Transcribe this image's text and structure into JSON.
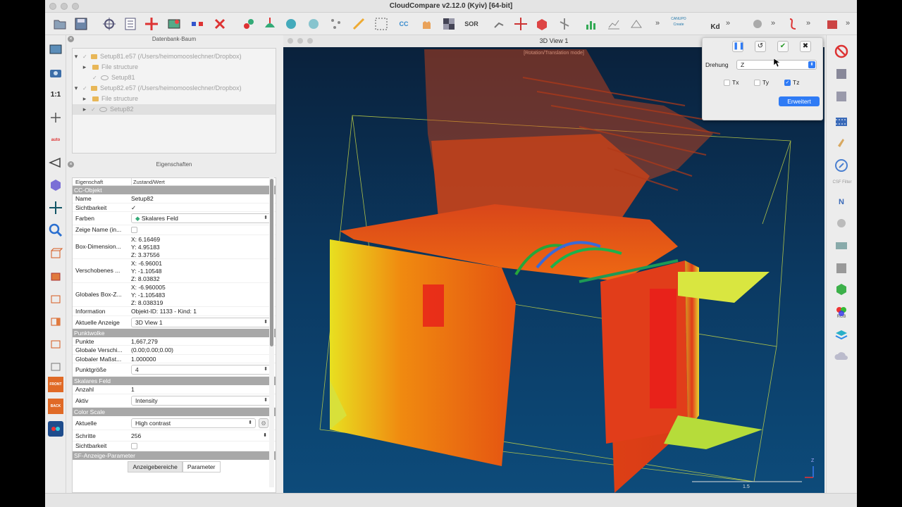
{
  "app": {
    "title": "CloudCompare v2.12.0 (Kyiv) [64-bit]"
  },
  "toolbar": {
    "more1": "»",
    "more2": "»",
    "more3": "»",
    "more4": "»",
    "more5": "»",
    "canupo": "CANUPO",
    "create": "Create",
    "kd": "Kd",
    "sor": "SOR",
    "ccc": "CC"
  },
  "left_toolbar": {
    "scale_label": "1:1",
    "front_label": "FRONT",
    "back_label": "BACK",
    "auto_label": "auto"
  },
  "db_tree": {
    "title": "Datenbank-Baum",
    "items": [
      {
        "label": "Setup81.e57 (/Users/heimomooslechner/Dropbox)"
      },
      {
        "label": "File structure"
      },
      {
        "label": "Setup81"
      },
      {
        "label": "Setup82.e57 (/Users/heimomooslechner/Dropbox)"
      },
      {
        "label": "File structure"
      },
      {
        "label": "Setup82"
      }
    ]
  },
  "properties": {
    "title": "Eigenschaften",
    "col_prop": "Eigenschaft",
    "col_val": "Zustand/Wert",
    "sections": {
      "cc": "CC-Objekt",
      "cloud": "Punktwolke",
      "sf": "Skalares Feld",
      "color": "Color Scale",
      "sfparams": "SF-Anzeige-Parameter"
    },
    "rows": {
      "name_k": "Name",
      "name_v": "Setup82",
      "vis_k": "Sichtbarkeit",
      "vis_v": "✓",
      "colors_k": "Farben",
      "colors_v": "Skalares Feld",
      "showname_k": "Zeige Name (in...",
      "box_k": "Box-Dimension...",
      "box_x": "X: 6.16469",
      "box_y": "Y: 4.95183",
      "box_z": "Z: 3.37556",
      "shift_k": "Verschobenes ...",
      "shift_x": "X: -6.96001",
      "shift_y": "Y: -1.10548",
      "shift_z": "Z: 8.03832",
      "gbox_k": "Globales Box-Z...",
      "gbox_x": "X: -6.960005",
      "gbox_y": "Y: -1.105483",
      "gbox_z": "Z: 8.038319",
      "info_k": "Information",
      "info_v": "Objekt-ID: 1133 - Kind: 1",
      "disp_k": "Aktuelle Anzeige",
      "disp_v": "3D View 1",
      "pts_k": "Punkte",
      "pts_v": "1,667,279",
      "gshift_k": "Globale Verschi...",
      "gshift_v": "(0.00;0.00;0.00)",
      "gscale_k": "Globaler Maßst...",
      "gscale_v": "1.000000",
      "psize_k": "Punktgröße",
      "psize_v": "4",
      "count_k": "Anzahl",
      "count_v": "1",
      "active_k": "Aktiv",
      "active_v": "Intensity",
      "cur_k": "Aktuelle",
      "cur_v": "High contrast",
      "steps_k": "Schritte",
      "steps_v": "256",
      "svis_k": "Sichtbarkeit"
    },
    "tabs": {
      "ranges": "Anzeigebereiche",
      "params": "Parameter"
    }
  },
  "view": {
    "title": "3D View 1",
    "mode": "[Rotation/Translation mode]",
    "scale_label": "1.5",
    "axis_label": "Z"
  },
  "dialog": {
    "rotation_label": "Drehung",
    "rotation_value": "Z",
    "tx": "Tx",
    "ty": "Ty",
    "tz": "Tz",
    "advanced": "Erweitert"
  },
  "right_toolbar": {
    "csf": "CSF Filter",
    "n_label": "N",
    "rgb": "RGB"
  },
  "colors": {
    "accent": "#2f7bf5",
    "section": "#a8a8a8"
  }
}
